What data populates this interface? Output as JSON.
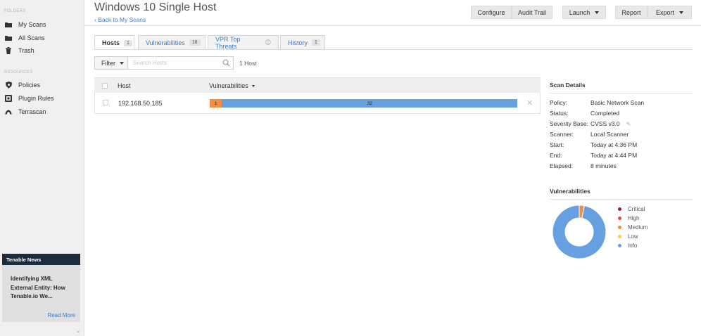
{
  "sidebar": {
    "folders_heading": "FOLDERS",
    "folders": [
      {
        "label": "My Scans",
        "icon": "folder-icon"
      },
      {
        "label": "All Scans",
        "icon": "folder-icon"
      },
      {
        "label": "Trash",
        "icon": "trash-icon"
      }
    ],
    "resources_heading": "RESOURCES",
    "resources": [
      {
        "label": "Policies",
        "icon": "shield-icon"
      },
      {
        "label": "Plugin Rules",
        "icon": "plugin-icon"
      },
      {
        "label": "Terrascan",
        "icon": "terrascan-icon"
      }
    ],
    "news": {
      "heading": "Tenable News",
      "lines": [
        "Identifying XML",
        "External Entity: How",
        "Tenable.io We..."
      ],
      "read_more": "Read More"
    },
    "collapse": "«"
  },
  "header": {
    "title": "Windows 10 Single Host",
    "back_link": "‹ Back to My Scans",
    "buttons": {
      "configure": "Configure",
      "audit_trail": "Audit Trail",
      "launch": "Launch",
      "report": "Report",
      "export": "Export"
    }
  },
  "tabs": [
    {
      "label": "Hosts",
      "count": "1",
      "active": true
    },
    {
      "label": "Vulnerabilities",
      "count": "18",
      "active": false
    },
    {
      "label": "VPR Top Threats",
      "count": "",
      "active": false
    },
    {
      "label": "History",
      "count": "1",
      "active": false
    }
  ],
  "filter": {
    "button": "Filter",
    "search_placeholder": "Search Hosts",
    "count_text": "1 Host"
  },
  "table": {
    "columns": [
      "Host",
      "Vulnerabilities"
    ],
    "rows": [
      {
        "host": "192.168.50.185",
        "medium": 1,
        "info": 32,
        "medium_label": "1",
        "info_label": "32"
      }
    ]
  },
  "scan_details": {
    "title": "Scan Details",
    "rows": [
      {
        "key": "Policy:",
        "value": "Basic Network Scan"
      },
      {
        "key": "Status:",
        "value": "Completed"
      },
      {
        "key": "Severity Base:",
        "value": "CVSS v3.0"
      },
      {
        "key": "Scanner:",
        "value": "Local Scanner"
      },
      {
        "key": "Start:",
        "value": "Today at 4:36 PM"
      },
      {
        "key": "End:",
        "value": "Today at 4:44 PM"
      },
      {
        "key": "Elapsed:",
        "value": "8 minutes"
      }
    ]
  },
  "vulnerabilities_panel": {
    "title": "Vulnerabilities",
    "legend": [
      {
        "label": "Critical",
        "color": "#91243e"
      },
      {
        "label": "High",
        "color": "#dd4b50"
      },
      {
        "label": "Medium",
        "color": "#f18c43"
      },
      {
        "label": "Low",
        "color": "#f8c851"
      },
      {
        "label": "Info",
        "color": "#67a0e0"
      }
    ],
    "donut_counts": {
      "critical": 0,
      "high": 0,
      "medium": 1,
      "low": 0,
      "info": 32
    }
  },
  "colors": {
    "link": "#3e7cc4",
    "sidebar_bg": "#f0f0f0",
    "news_header": "#1d2c3c",
    "medium": "#f18c43",
    "info": "#67a0e0"
  }
}
